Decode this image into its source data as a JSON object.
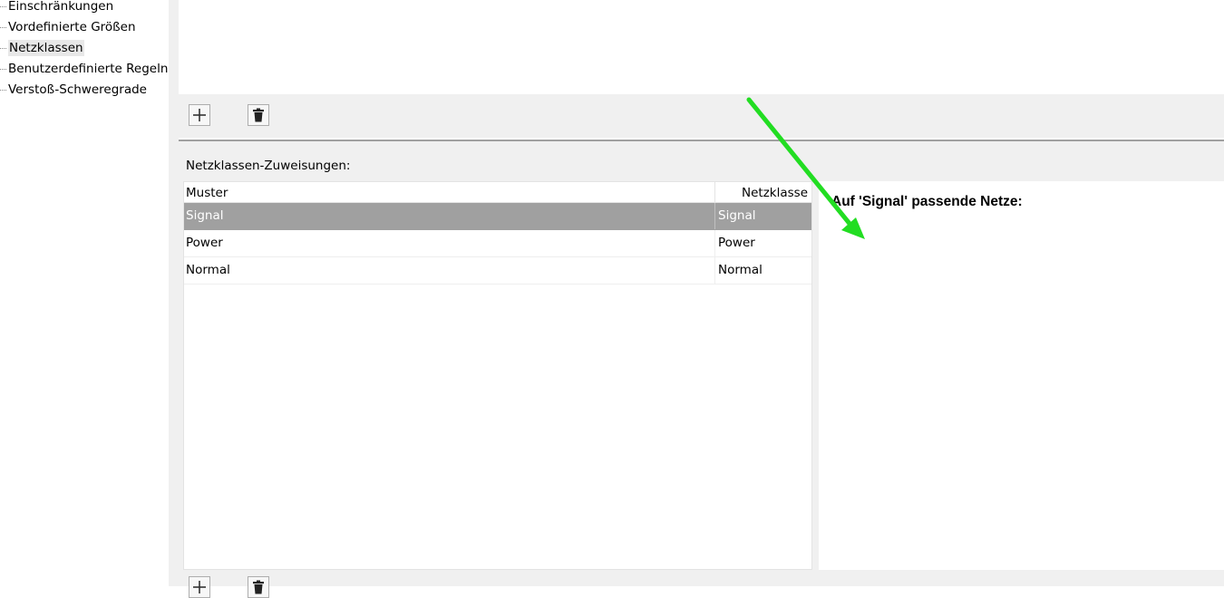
{
  "sidebar": {
    "items": [
      {
        "label": "Einschränkungen",
        "selected": false
      },
      {
        "label": "Vordefinierte Größen",
        "selected": false
      },
      {
        "label": "Netzklassen",
        "selected": true
      },
      {
        "label": "Benutzerdefinierte Regeln",
        "selected": false
      },
      {
        "label": "Verstoß-Schweregrade",
        "selected": false
      }
    ]
  },
  "toolbar": {
    "add_icon": "plus-icon",
    "delete_icon": "trash-icon"
  },
  "assignments": {
    "label": "Netzklassen-Zuweisungen:",
    "columns": [
      "Muster",
      "Netzklasse"
    ],
    "rows": [
      {
        "pattern": "Signal",
        "netclass": "Signal",
        "selected": true
      },
      {
        "pattern": "Power",
        "netclass": "Power",
        "selected": false
      },
      {
        "pattern": "Normal",
        "netclass": "Normal",
        "selected": false
      }
    ]
  },
  "matching_nets": {
    "title": "Auf 'Signal' passende Netze:"
  },
  "colors": {
    "selected_row": "#a0a0a0",
    "panel_bg": "#f0f0f0",
    "arrow": "#22dd22"
  }
}
